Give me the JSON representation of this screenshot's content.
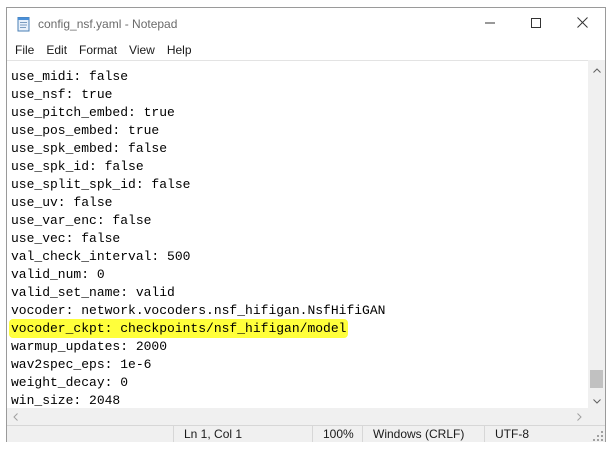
{
  "window": {
    "title": "config_nsf.yaml - Notepad"
  },
  "menu": [
    "File",
    "Edit",
    "Format",
    "View",
    "Help"
  ],
  "editor": {
    "lines": [
      {
        "text": "use_midi: false"
      },
      {
        "text": "use_nsf: true"
      },
      {
        "text": "use_pitch_embed: true"
      },
      {
        "text": "use_pos_embed: true"
      },
      {
        "text": "use_spk_embed: false"
      },
      {
        "text": "use_spk_id: false"
      },
      {
        "text": "use_split_spk_id: false"
      },
      {
        "text": "use_uv: false"
      },
      {
        "text": "use_var_enc: false"
      },
      {
        "text": "use_vec: false"
      },
      {
        "text": "val_check_interval: 500"
      },
      {
        "text": "valid_num: 0"
      },
      {
        "text": "valid_set_name: valid"
      },
      {
        "text": "vocoder: network.vocoders.nsf_hifigan.NsfHifiGAN"
      },
      {
        "text": "vocoder_ckpt: checkpoints/nsf_hifigan/model",
        "highlighted": true
      },
      {
        "text": "warmup_updates: 2000"
      },
      {
        "text": "wav2spec_eps: 1e-6"
      },
      {
        "text": "weight_decay: 0"
      },
      {
        "text": "win_size: 2048"
      }
    ],
    "highlight_color": "#ffff3b"
  },
  "status": {
    "position": "Ln 1, Col 1",
    "zoom": "100%",
    "line_ending": "Windows (CRLF)",
    "encoding": "UTF-8"
  },
  "icons": {
    "app": "notepad-icon",
    "minimize": "minimize-icon",
    "maximize": "maximize-icon",
    "close": "close-icon"
  }
}
